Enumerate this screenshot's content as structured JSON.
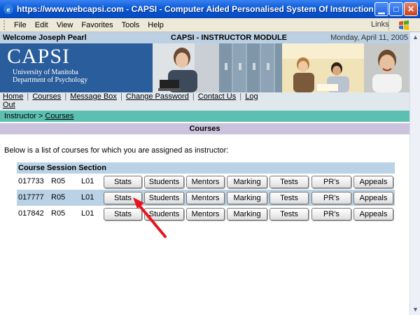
{
  "window": {
    "title": "https://www.webcapsi.com - CAPSI - Computer Aided Personalised System Of Instruction - Universi - Microsof...",
    "menu": [
      "File",
      "Edit",
      "View",
      "Favorites",
      "Tools",
      "Help"
    ],
    "links_label": "Links",
    "min_glyph": "▁",
    "max_glyph": "□",
    "close_glyph": "✕"
  },
  "header": {
    "welcome": "Welcome Joseph Pearl",
    "module": "CAPSI - INSTRUCTOR MODULE",
    "date": "Monday, April 11, 2005"
  },
  "banner": {
    "logo": "CAPSI",
    "university": "University of Manitoba",
    "department": "Department of Psychology"
  },
  "nav": {
    "home": "Home",
    "courses": "Courses",
    "message_box": "Message Box",
    "change_password": "Change Password",
    "contact_us": "Contact Us",
    "log": "Log",
    "out": "Out",
    "separator": "|"
  },
  "breadcrumb": {
    "root": "Instructor",
    "separator": ">",
    "current": "Courses"
  },
  "section_title": "Courses",
  "intro": "Below is a list of courses for which you are assigned as instructor:",
  "table": {
    "header": "Course Session Section",
    "buttons": {
      "stats": "Stats",
      "students": "Students",
      "mentors": "Mentors",
      "marking": "Marking",
      "tests": "Tests",
      "prs": "PR's",
      "appeals": "Appeals"
    },
    "rows": [
      {
        "course": "017733",
        "session": "R05",
        "section": "L01"
      },
      {
        "course": "017777",
        "session": "R05",
        "section": "L01"
      },
      {
        "course": "017842",
        "session": "R05",
        "section": "L01"
      }
    ]
  },
  "colors": {
    "titlebar": "#0a5ad6",
    "header_strip": "#bcd0e4",
    "logo_bg": "#2a5d9b",
    "breadcrumb_bg": "#5bbfb2",
    "section_bg": "#cbc3dd",
    "row_highlight": "#b9d2e6",
    "annotation_arrow": "#e8141a"
  }
}
